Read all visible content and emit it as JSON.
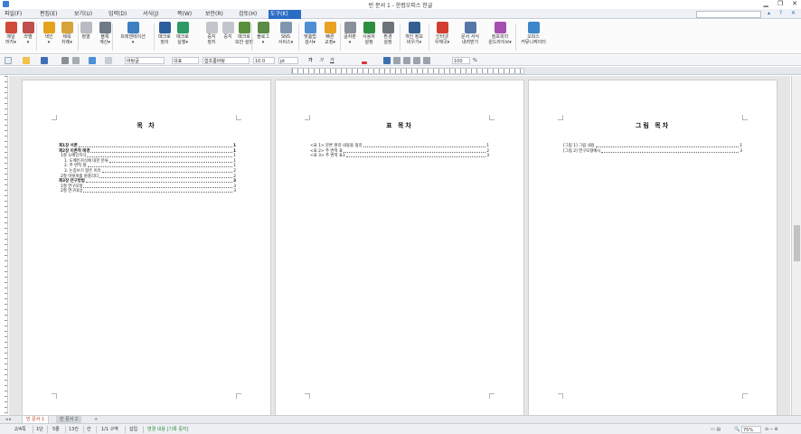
{
  "window": {
    "title": "빈 문서 1 - 한컴오피스 한글",
    "min": "▁",
    "restore": "❐",
    "close": "✕"
  },
  "menu": {
    "items": [
      "파일(F)",
      "편집(E)",
      "보기(U)",
      "입력(D)",
      "서식(J)",
      "쪽(W)",
      "보안(R)",
      "검토(H)",
      "도구(K)"
    ],
    "active_index": 8,
    "right_icons": [
      "▴",
      "?",
      "✕"
    ]
  },
  "ribbon": {
    "buttons": [
      {
        "label": "메일\n머지▾",
        "icon": "mail-merge-icon",
        "color": "#d04a3a"
      },
      {
        "label": "라벨\n▾",
        "icon": "label-icon",
        "color": "#c0504d"
      },
      {
        "label": "색인\n▾",
        "icon": "index-icon",
        "color": "#e3a31b"
      },
      {
        "label": "제목\n차례▾",
        "icon": "toc-icon",
        "color": "#d7a23a"
      },
      {
        "label": "정렬",
        "icon": "sort-icon",
        "color": "#b8bcc2"
      },
      {
        "label": "블록\n계산▾",
        "icon": "block-calc-icon",
        "color": "#6e7a86"
      },
      {
        "label": "프레젠테이션\n▾",
        "icon": "presentation-icon",
        "color": "#3d7fc0"
      },
      {
        "label": "매크로\n정의",
        "icon": "macro-define-icon",
        "color": "#2c5f9e"
      },
      {
        "label": "매크로\n실행▾",
        "icon": "macro-run-icon",
        "color": "#2d9a63"
      },
      {
        "label": "중지\n정지",
        "icon": "macro-stop-icon",
        "color": "#c2c6cc"
      },
      {
        "label": "중지",
        "icon": "macro-pause-icon",
        "color": "#c2c6cc"
      },
      {
        "label": "매크로\n보안 설정",
        "icon": "macro-security-icon",
        "color": "#5a8f3c"
      },
      {
        "label": "블로그\n▾",
        "icon": "blog-icon",
        "color": "#5b8b44"
      },
      {
        "label": "SNS\n서비스▾",
        "icon": "sns-icon",
        "color": "#7f96ad"
      },
      {
        "label": "맞춤법\n검사▾",
        "icon": "spellcheck-icon",
        "color": "#4f8fd1"
      },
      {
        "label": "빠른\n교정▾",
        "icon": "quick-correct-icon",
        "color": "#e8a21f"
      },
      {
        "label": "글자판\n▾",
        "icon": "keyboard-icon",
        "color": "#8a9099"
      },
      {
        "label": "사용자\n설정",
        "icon": "user-settings-icon",
        "color": "#2f8d3f"
      },
      {
        "label": "환경\n설정",
        "icon": "gear-icon",
        "color": "#6d737b"
      },
      {
        "label": "개인 정보\n비우기▾",
        "icon": "privacy-icon",
        "color": "#365f91"
      },
      {
        "label": "인터넷\n우체국▾",
        "icon": "internet-post-icon",
        "color": "#d23f31"
      },
      {
        "label": "문서 서식\n내려받기",
        "icon": "template-download-icon",
        "color": "#5577a8"
      },
      {
        "label": "컴포피리\n윈드라이브▾",
        "icon": "cloud-drive-icon",
        "color": "#a64fb0"
      },
      {
        "label": "오피스\n커뮤니케이터",
        "icon": "communicator-icon",
        "color": "#3c86c9"
      }
    ]
  },
  "format": {
    "style": "바탕글",
    "font_lang": "대표",
    "font": "함초롬바탕",
    "size": "10.0",
    "unit": "pt",
    "zoom_ratio": "100",
    "pct": "%",
    "bold": "가",
    "italic": "가",
    "underline": "가"
  },
  "pages": [
    {
      "title": "목 차",
      "lines": [
        {
          "text": "제1장 서론",
          "page": "1"
        },
        {
          "text": "제2장 이론적 배경",
          "page": "1"
        },
        {
          "text": "1절 도메인지식",
          "page": "1"
        },
        {
          "text": "1. 도메인지식에 대한 분류",
          "page": "1"
        },
        {
          "text": "2. 주 변적 항",
          "page": "1"
        },
        {
          "text": "3. 논증쓰기 항은 이유",
          "page": "2"
        },
        {
          "text": "2절 이렇게줍 원풍리티",
          "page": "2"
        },
        {
          "text": "제3장 연구방법",
          "page": "3"
        },
        {
          "text": "1절 연구모형",
          "page": "3"
        },
        {
          "text": "2절 연구대상",
          "page": "3"
        }
      ]
    },
    {
      "title": "표 목차",
      "lines": [
        {
          "text": "<표 1> 문론 원리 내용을 정리",
          "page": "1"
        },
        {
          "text": "<표 2> 주 변적 표",
          "page": "2"
        },
        {
          "text": "<표 3> 주 변적 표3",
          "page": "3"
        }
      ]
    },
    {
      "title": "그림 목차",
      "lines": [
        {
          "text": "[그림 1] 그림 내용",
          "page": "1"
        },
        {
          "text": "[그림 2] 연구모형예시",
          "page": "3"
        }
      ]
    }
  ],
  "tabs": {
    "items": [
      "빈 문서 1",
      "빈 문서 2"
    ],
    "add": "+"
  },
  "status": {
    "pages": "2/4쪽",
    "column": "1단",
    "line": "5줄",
    "col": "13칸",
    "char": "칸",
    "section": "1/1 구역",
    "insert": "삽입",
    "track": "변경 내용 [기록 중지]",
    "zoom": "75%"
  }
}
